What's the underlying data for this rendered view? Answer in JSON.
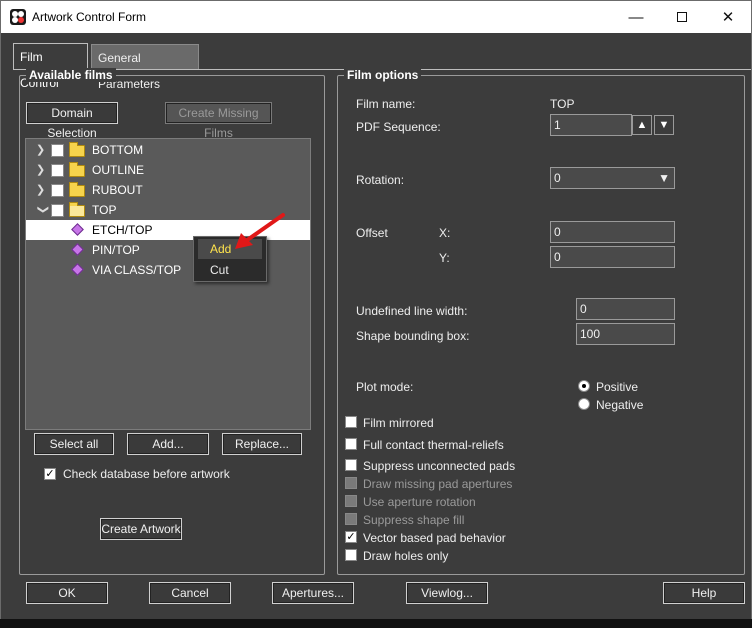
{
  "window": {
    "title": "Artwork Control Form"
  },
  "tabs": [
    {
      "label": "Film Control"
    },
    {
      "label": "General Parameters"
    }
  ],
  "available_films": {
    "legend": "Available films",
    "domain_selection": "Domain Selection",
    "create_missing": "Create Missing Films",
    "tree": [
      {
        "label": "BOTTOM",
        "type": "folder",
        "expanded": false
      },
      {
        "label": "OUTLINE",
        "type": "folder",
        "expanded": false
      },
      {
        "label": "RUBOUT",
        "type": "folder",
        "expanded": false
      },
      {
        "label": "TOP",
        "type": "folder",
        "expanded": true
      },
      {
        "label": "ETCH/TOP",
        "type": "layer",
        "selected": true
      },
      {
        "label": "PIN/TOP",
        "type": "layer"
      },
      {
        "label": "VIA CLASS/TOP",
        "type": "layer"
      }
    ],
    "context_menu": [
      {
        "label": "Add"
      },
      {
        "label": "Cut"
      }
    ],
    "select_all": "Select all",
    "add": "Add...",
    "replace": "Replace...",
    "check_db": "Check database before artwork",
    "check_db_checked": true,
    "create_artwork": "Create Artwork"
  },
  "film_options": {
    "legend": "Film options",
    "film_name_label": "Film name:",
    "film_name_value": "TOP",
    "pdf_sequence_label": "PDF Sequence:",
    "pdf_sequence_value": "1",
    "rotation_label": "Rotation:",
    "rotation_value": "0",
    "offset_label": "Offset",
    "x_label": "X:",
    "x_value": "0",
    "y_label": "Y:",
    "y_value": "0",
    "undef_line_label": "Undefined line width:",
    "undef_line_value": "0",
    "shape_bbox_label": "Shape bounding box:",
    "shape_bbox_value": "100",
    "plot_mode_label": "Plot mode:",
    "plot_positive": "Positive",
    "plot_negative": "Negative",
    "checkboxes": [
      {
        "label": "Film mirrored",
        "checked": false,
        "enabled": true
      },
      {
        "label": "Full contact thermal-reliefs",
        "checked": false,
        "enabled": true
      },
      {
        "label": "Suppress unconnected pads",
        "checked": false,
        "enabled": true
      },
      {
        "label": "Draw missing pad apertures",
        "checked": false,
        "enabled": false
      },
      {
        "label": "Use aperture rotation",
        "checked": false,
        "enabled": false
      },
      {
        "label": "Suppress shape fill",
        "checked": false,
        "enabled": false
      },
      {
        "label": "Vector based pad behavior",
        "checked": true,
        "enabled": true
      },
      {
        "label": "Draw holes only",
        "checked": false,
        "enabled": true
      }
    ]
  },
  "footer": {
    "ok": "OK",
    "cancel": "Cancel",
    "apertures": "Apertures...",
    "viewlog": "Viewlog...",
    "help": "Help"
  }
}
